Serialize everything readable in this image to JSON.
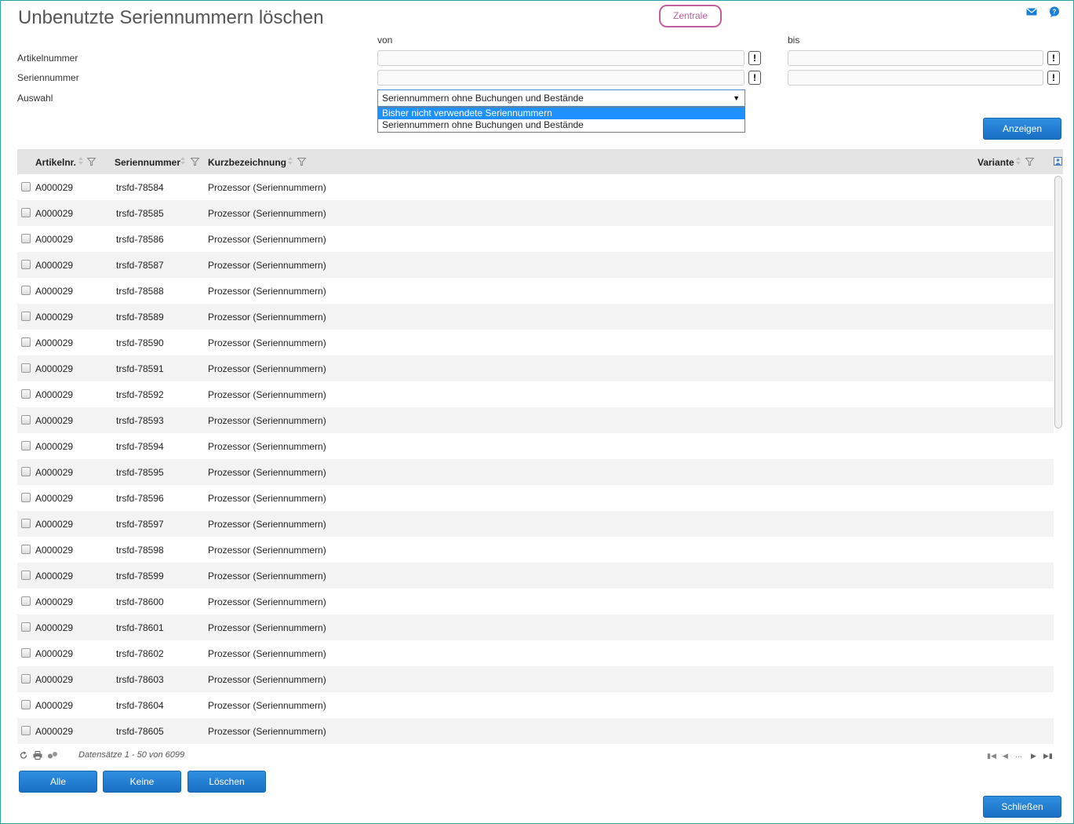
{
  "page": {
    "title": "Unbenutzte Seriennummern löschen",
    "location_badge": "Zentrale",
    "icons": {
      "mail": "mail-icon",
      "help": "help-icon"
    }
  },
  "filters": {
    "from_label": "von",
    "to_label": "bis",
    "rows": [
      {
        "label": "Artikelnummer",
        "from_value": "",
        "to_value": "",
        "button_label": "!"
      },
      {
        "label": "Seriennummer",
        "from_value": "",
        "to_value": "",
        "button_label": "!"
      }
    ],
    "selection": {
      "label": "Auswahl",
      "value": "Seriennummern ohne Buchungen und Bestände",
      "options": [
        "Bisher nicht verwendete Seriennummern",
        "Seriennummern ohne Buchungen und Bestände"
      ],
      "highlighted_option": "Bisher nicht verwendete Seriennummern"
    },
    "show_button": "Anzeigen"
  },
  "grid": {
    "columns": {
      "article": "Artikelnr.",
      "serial": "Seriennummer",
      "short_desc": "Kurzbezeichnung",
      "variant": "Variante"
    },
    "rows": [
      {
        "article": "A000029",
        "serial": "trsfd-78584",
        "short_desc": "Prozessor (Seriennummern)",
        "variant": ""
      },
      {
        "article": "A000029",
        "serial": "trsfd-78585",
        "short_desc": "Prozessor (Seriennummern)",
        "variant": ""
      },
      {
        "article": "A000029",
        "serial": "trsfd-78586",
        "short_desc": "Prozessor (Seriennummern)",
        "variant": ""
      },
      {
        "article": "A000029",
        "serial": "trsfd-78587",
        "short_desc": "Prozessor (Seriennummern)",
        "variant": ""
      },
      {
        "article": "A000029",
        "serial": "trsfd-78588",
        "short_desc": "Prozessor (Seriennummern)",
        "variant": ""
      },
      {
        "article": "A000029",
        "serial": "trsfd-78589",
        "short_desc": "Prozessor (Seriennummern)",
        "variant": ""
      },
      {
        "article": "A000029",
        "serial": "trsfd-78590",
        "short_desc": "Prozessor (Seriennummern)",
        "variant": ""
      },
      {
        "article": "A000029",
        "serial": "trsfd-78591",
        "short_desc": "Prozessor (Seriennummern)",
        "variant": ""
      },
      {
        "article": "A000029",
        "serial": "trsfd-78592",
        "short_desc": "Prozessor (Seriennummern)",
        "variant": ""
      },
      {
        "article": "A000029",
        "serial": "trsfd-78593",
        "short_desc": "Prozessor (Seriennummern)",
        "variant": ""
      },
      {
        "article": "A000029",
        "serial": "trsfd-78594",
        "short_desc": "Prozessor (Seriennummern)",
        "variant": ""
      },
      {
        "article": "A000029",
        "serial": "trsfd-78595",
        "short_desc": "Prozessor (Seriennummern)",
        "variant": ""
      },
      {
        "article": "A000029",
        "serial": "trsfd-78596",
        "short_desc": "Prozessor (Seriennummern)",
        "variant": ""
      },
      {
        "article": "A000029",
        "serial": "trsfd-78597",
        "short_desc": "Prozessor (Seriennummern)",
        "variant": ""
      },
      {
        "article": "A000029",
        "serial": "trsfd-78598",
        "short_desc": "Prozessor (Seriennummern)",
        "variant": ""
      },
      {
        "article": "A000029",
        "serial": "trsfd-78599",
        "short_desc": "Prozessor (Seriennummern)",
        "variant": ""
      },
      {
        "article": "A000029",
        "serial": "trsfd-78600",
        "short_desc": "Prozessor (Seriennummern)",
        "variant": ""
      },
      {
        "article": "A000029",
        "serial": "trsfd-78601",
        "short_desc": "Prozessor (Seriennummern)",
        "variant": ""
      },
      {
        "article": "A000029",
        "serial": "trsfd-78602",
        "short_desc": "Prozessor (Seriennummern)",
        "variant": ""
      },
      {
        "article": "A000029",
        "serial": "trsfd-78603",
        "short_desc": "Prozessor (Seriennummern)",
        "variant": ""
      },
      {
        "article": "A000029",
        "serial": "trsfd-78604",
        "short_desc": "Prozessor (Seriennummern)",
        "variant": ""
      },
      {
        "article": "A000029",
        "serial": "trsfd-78605",
        "short_desc": "Prozessor (Seriennummern)",
        "variant": ""
      }
    ]
  },
  "footer": {
    "records_info": "Datensätze 1 - 50 von 6099",
    "pager_ellipsis": "...",
    "icons": [
      "refresh-icon",
      "print-icon",
      "settings-icon"
    ]
  },
  "actions": {
    "select_all": "Alle",
    "select_none": "Keine",
    "delete": "Löschen",
    "close": "Schließen"
  },
  "colors": {
    "accent_blue": "#1a6fc4",
    "badge_pink": "#c0609a",
    "frame_teal": "#2aa3a8",
    "highlight": "#1e90ff"
  }
}
